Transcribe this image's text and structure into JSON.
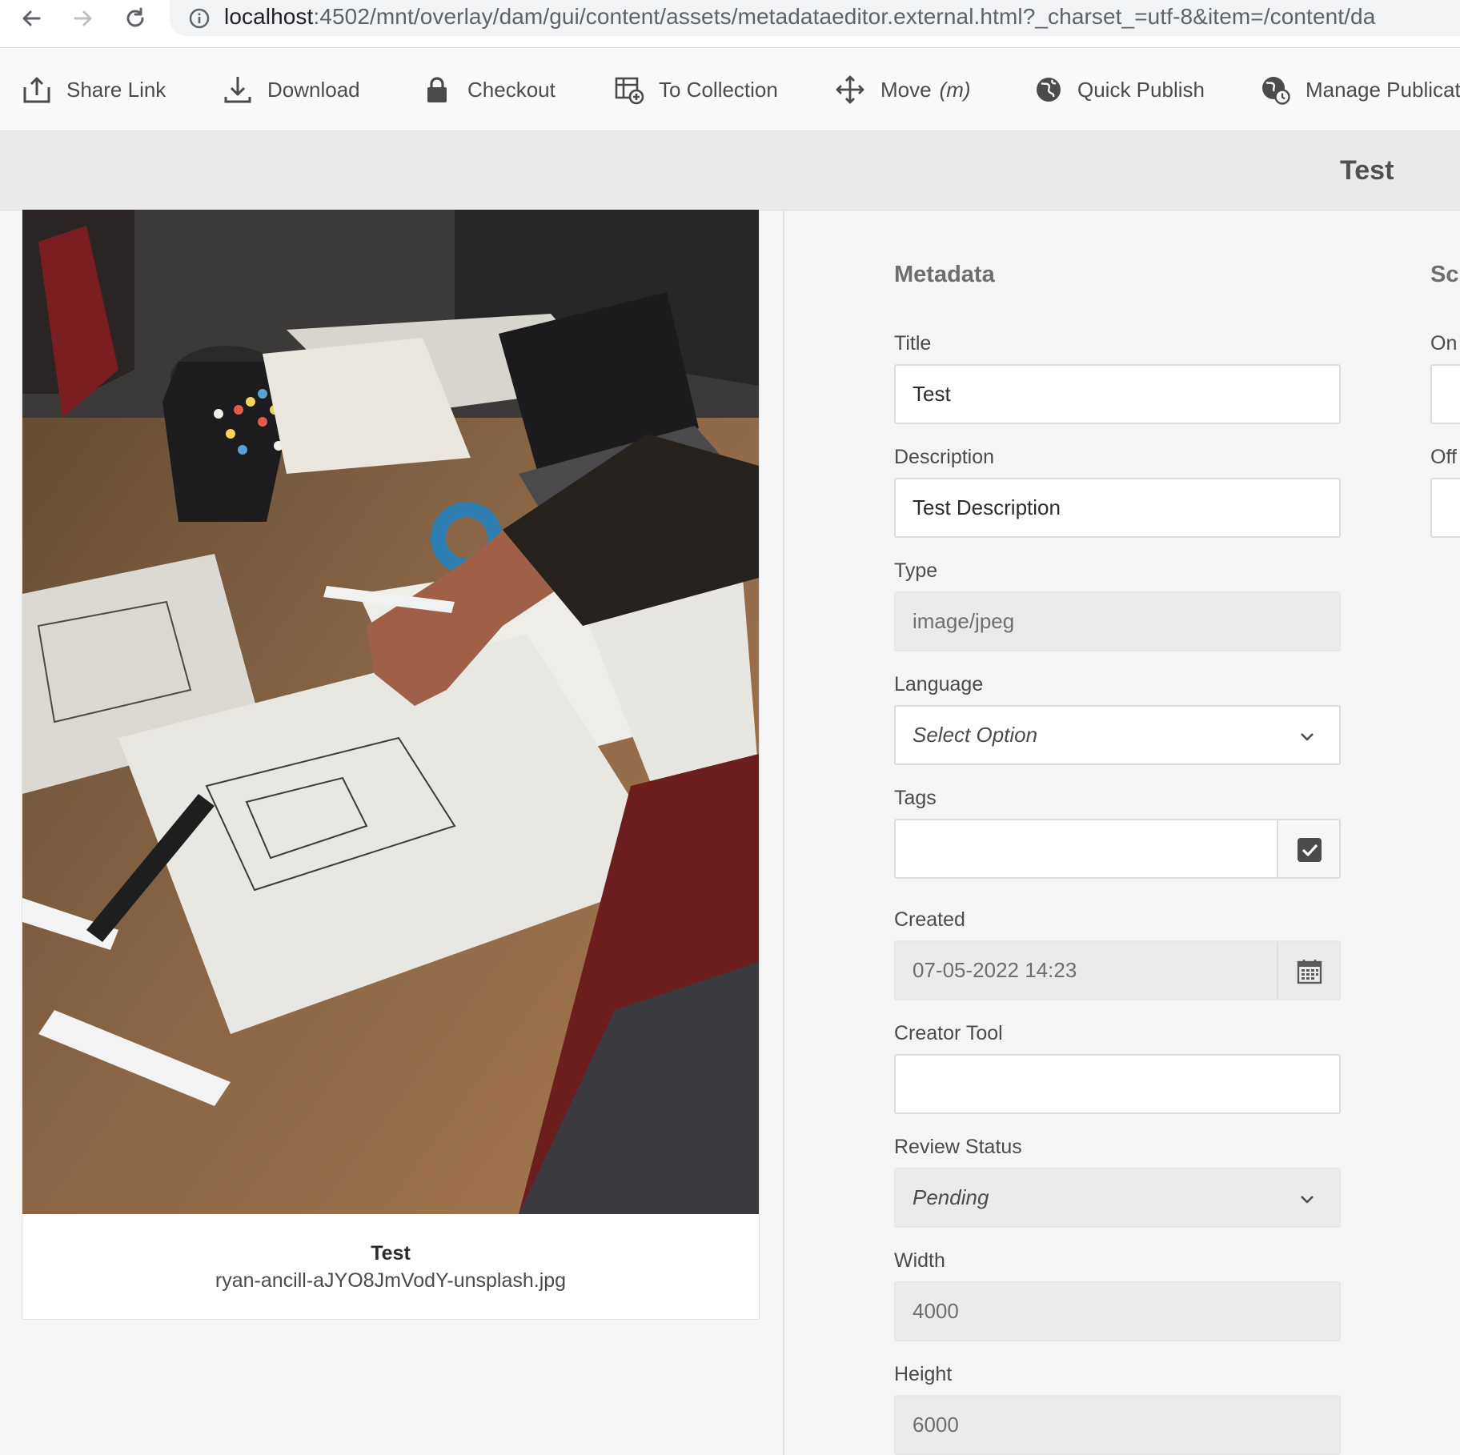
{
  "browser": {
    "url_host": "localhost",
    "url_rest": ":4502/mnt/overlay/dam/gui/content/assets/metadataeditor.external.html?_charset_=utf-8&item=/content/da"
  },
  "toolbar": {
    "share_link": "Share Link",
    "download": "Download",
    "checkout": "Checkout",
    "to_collection": "To Collection",
    "move": "Move",
    "move_shortcut": "(m)",
    "quick_publish": "Quick Publish",
    "manage_publication": "Manage Publicatio"
  },
  "header": {
    "title": "Test"
  },
  "asset": {
    "name": "Test",
    "filename": "ryan-ancill-aJYO8JmVodY-unsplash.jpg"
  },
  "metadata": {
    "section_title": "Metadata",
    "title_label": "Title",
    "title_value": "Test",
    "description_label": "Description",
    "description_value": "Test Description",
    "type_label": "Type",
    "type_value": "image/jpeg",
    "language_label": "Language",
    "language_value": "Select Option",
    "tags_label": "Tags",
    "tags_value": "",
    "created_label": "Created",
    "created_value": "07-05-2022 14:23",
    "creator_tool_label": "Creator Tool",
    "creator_tool_value": "",
    "review_status_label": "Review Status",
    "review_status_value": "Pending",
    "width_label": "Width",
    "width_value": "4000",
    "height_label": "Height",
    "height_value": "6000"
  },
  "schedule": {
    "section_title": "Sch",
    "on_label": "On",
    "off_label": "Off"
  },
  "icons": {
    "back": "arrow-left-icon",
    "forward": "arrow-right-icon",
    "reload": "reload-icon",
    "info": "info-icon",
    "share": "share-icon",
    "download": "download-icon",
    "lock": "lock-icon",
    "collection": "collection-add-icon",
    "move": "move-icon",
    "publish": "globe-icon",
    "manage": "globe-clock-icon",
    "chevron": "chevron-down-icon",
    "tag_picker": "checkbox-icon",
    "calendar": "calendar-icon"
  },
  "colors": {
    "accent": "#2c2c2c",
    "toolbar_bg": "#fafafa",
    "readonly_bg": "#ebebeb"
  }
}
